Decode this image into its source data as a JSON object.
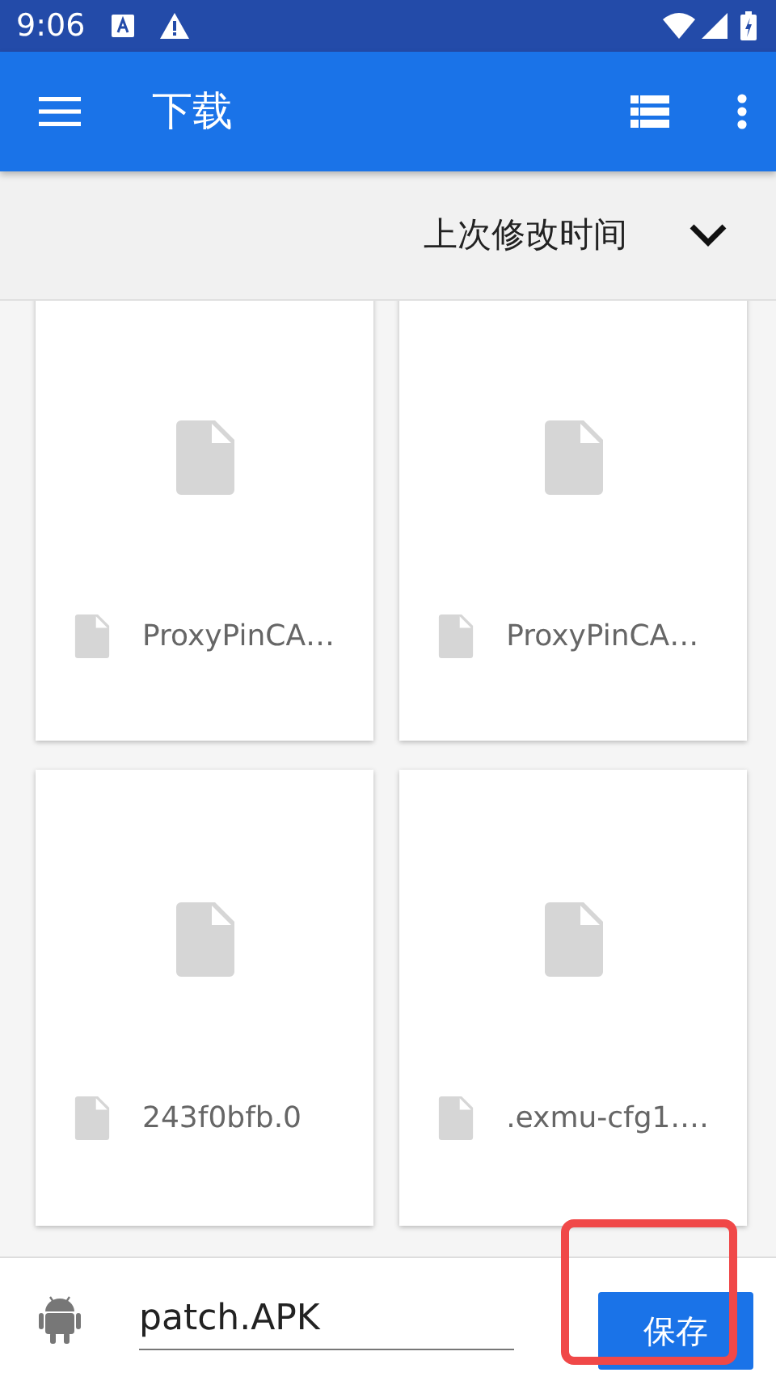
{
  "status_bar": {
    "time": "9:06"
  },
  "app_bar": {
    "title": "下载"
  },
  "sort": {
    "label": "上次修改时间"
  },
  "files": [
    {
      "name": "ProxyPinCA…"
    },
    {
      "name": "ProxyPinCA…"
    },
    {
      "name": "243f0bfb.0"
    },
    {
      "name": ".exmu-cfg1.…"
    }
  ],
  "save_bar": {
    "filename": "patch.APK",
    "button": "保存"
  }
}
